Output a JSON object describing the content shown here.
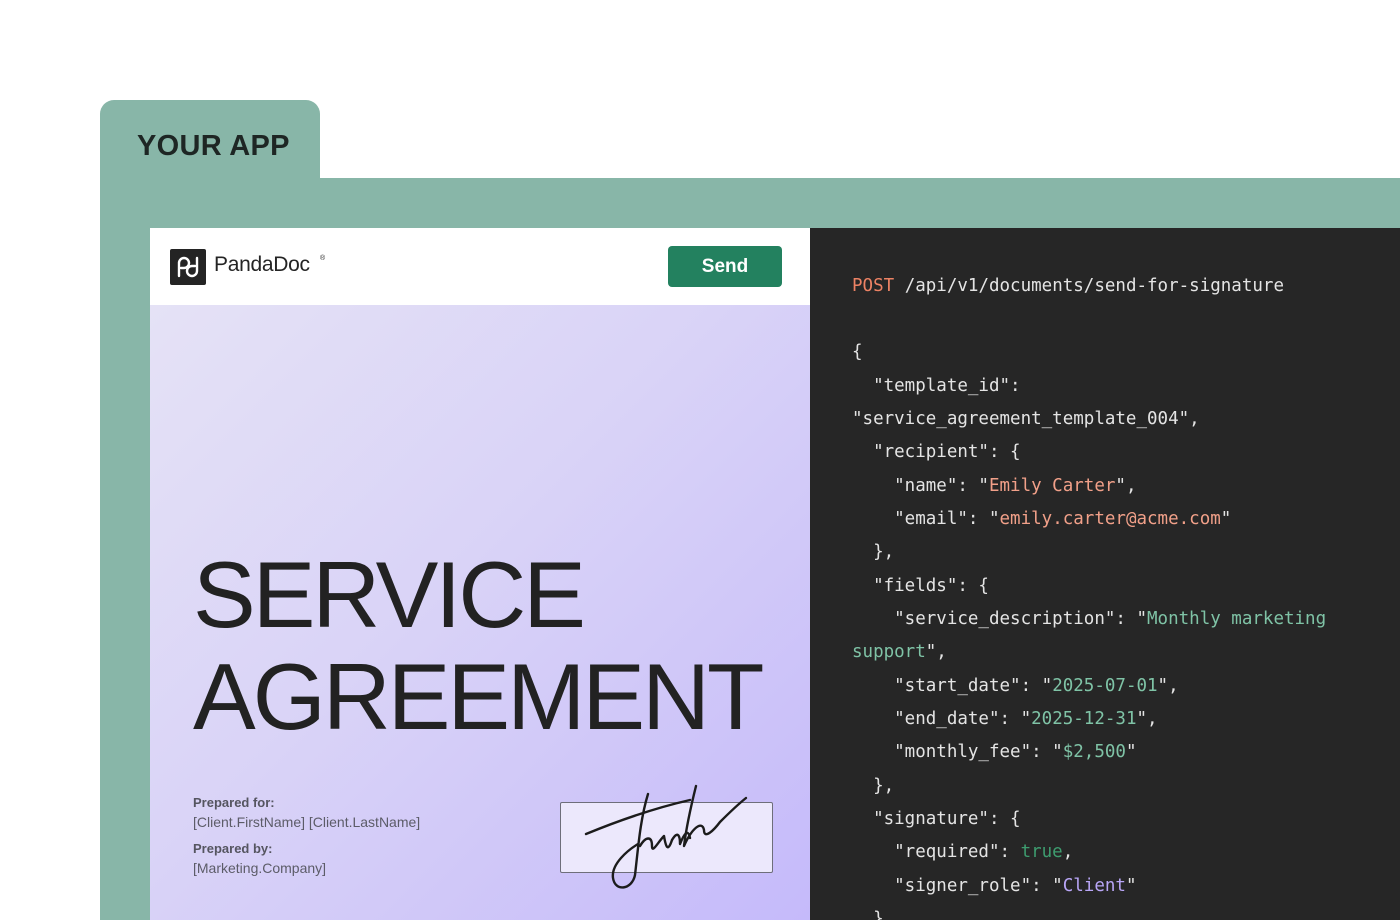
{
  "app_tab": {
    "label": "YOUR APP"
  },
  "colors": {
    "frame": "#88b6a8",
    "send_button": "#23815f",
    "code_background": "#262626",
    "doc_gradient_start": "#e5e2f6",
    "doc_gradient_end": "#c5bafa"
  },
  "document": {
    "brand": "PandaDoc",
    "brand_reg_mark": "®",
    "logo_icon": "pandadoc-logo-icon",
    "send_label": "Send",
    "title_line1": "SERVICE",
    "title_line2": "AGREEMENT",
    "prepared_for_label": "Prepared for:",
    "prepared_for_value": "[Client.FirstName] [Client.LastName]",
    "prepared_by_label": "Prepared by:",
    "prepared_by_value": "[Marketing.Company]",
    "signature_icon": "handwritten-signature"
  },
  "code": {
    "method": "POST",
    "endpoint": " /api/v1/documents/send-for-signature",
    "open_brace": "{",
    "template_key": "  \"template_id\":",
    "template_value": "\"service_agreement_template_004\",",
    "recipient_open": "  \"recipient\": {",
    "name_key": "    \"name\": \"",
    "name_value": "Emily Carter",
    "name_end": "\",",
    "email_key": "    \"email\": \"",
    "email_value": "emily.carter@acme.com",
    "email_end": "\"",
    "recipient_close": "  },",
    "fields_open": "  \"fields\": {",
    "desc_key": "    \"service_description\": \"",
    "desc_value_1": "Monthly marketing",
    "desc_value_2": "support",
    "desc_end": "\",",
    "start_key": "    \"start_date\": \"",
    "start_value": "2025-07-01",
    "start_end": "\",",
    "end_key": "    \"end_date\": \"",
    "end_value": "2025-12-31",
    "end_end": "\",",
    "fee_key": "    \"monthly_fee\": \"",
    "fee_value": "$2,500",
    "fee_end": "\"",
    "fields_close": "  },",
    "signature_open": "  \"signature\": {",
    "required_key": "    \"required\": ",
    "required_value": "true",
    "required_end": ",",
    "role_key": "    \"signer_role\": \"",
    "role_value": "Client",
    "role_end": "\"",
    "signature_close": "  }"
  }
}
